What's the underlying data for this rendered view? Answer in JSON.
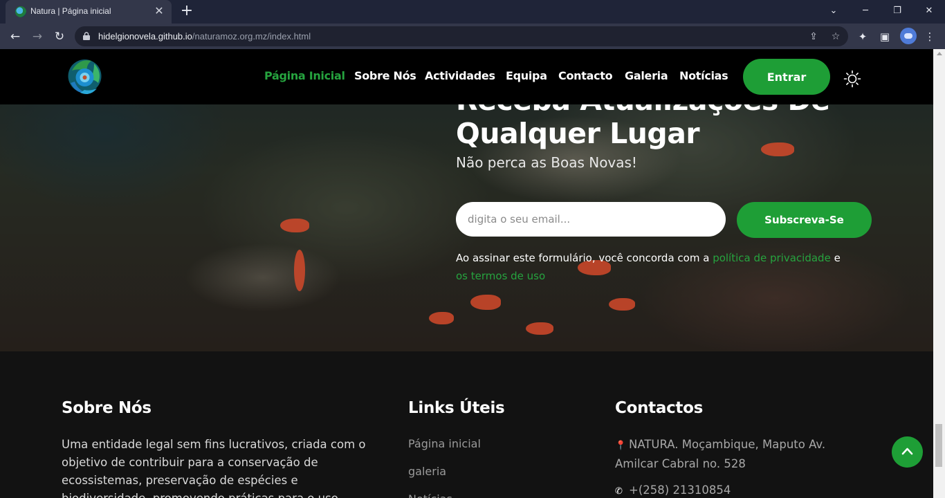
{
  "browser": {
    "tab_title": "Natura | Página inicial",
    "url_host": "hidelgionovela.github.io",
    "url_path": "/naturamoz.org.mz/index.html"
  },
  "nav": {
    "links": [
      "Página Inicial",
      "Sobre Nós",
      "Actividades",
      "Equipa",
      "Contacto",
      "Galeria",
      "Notícias"
    ],
    "active_index": 0,
    "login_label": "Entrar"
  },
  "newsletter": {
    "heading_line1": "Receba Atualizações De",
    "heading_line2": "Qualquer Lugar",
    "subheading": "Não perca as Boas Novas!",
    "email_placeholder": "digita o seu email...",
    "subscribe_label": "Subscreva-Se",
    "consent_text": "Ao assinar este formulário, você concorda com a ",
    "privacy_link": "política de privacidade",
    "consent_and": " e",
    "terms_link": "os termos de uso"
  },
  "footer": {
    "about_title": "Sobre Nós",
    "about_text": "Uma entidade legal sem fins lucrativos, criada com o objetivo de contribuir para a conservação de ecossistemas, preservação de espécies e biodiversidade, promovendo práticas para o uso",
    "links_title": "Links Úteis",
    "links": [
      "Página inicial",
      "galeria",
      "Notícias"
    ],
    "contacts_title": "Contactos",
    "address": "NATURA. Moçambique, Maputo Av. Amilcar Cabral no. 528",
    "phone": "+(258) 21310854"
  },
  "colors": {
    "accent": "#1e9e36",
    "link_green": "#26a43f",
    "navbar_bg": "#000000",
    "footer_bg": "#121212"
  },
  "icons": [
    "lock-icon",
    "share-icon",
    "star-icon",
    "extensions-icon",
    "sidebar-icon",
    "sun-icon",
    "map-pin-icon",
    "phone-icon",
    "chevron-up-icon"
  ]
}
